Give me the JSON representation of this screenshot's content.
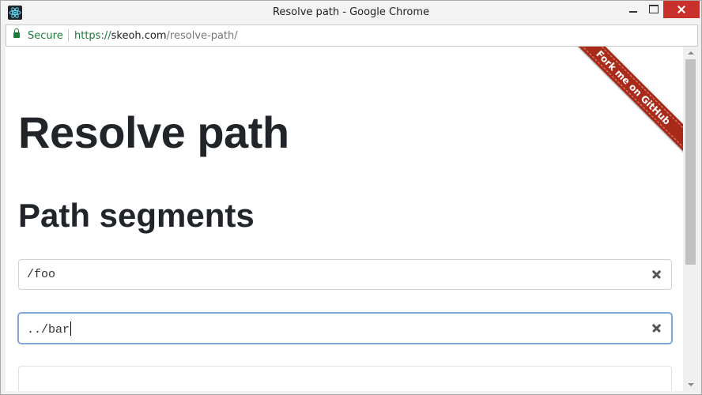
{
  "window": {
    "title": "Resolve path - Google Chrome",
    "app_icon": "react-logo-icon"
  },
  "address_bar": {
    "secure_label": "Secure",
    "url_scheme": "https://",
    "url_host": "skeoh.com",
    "url_path": "/resolve-path/"
  },
  "page": {
    "title": "Resolve path",
    "section_heading": "Path segments",
    "ribbon_label": "Fork me on GitHub",
    "segments": [
      {
        "value": "/foo",
        "focused": false
      },
      {
        "value": "../bar",
        "focused": true
      }
    ]
  },
  "colors": {
    "ribbon": "#aa2a1a",
    "secure_green": "#1e7b3a",
    "focus_ring": "#80a7d6",
    "heading_text": "#212529"
  }
}
